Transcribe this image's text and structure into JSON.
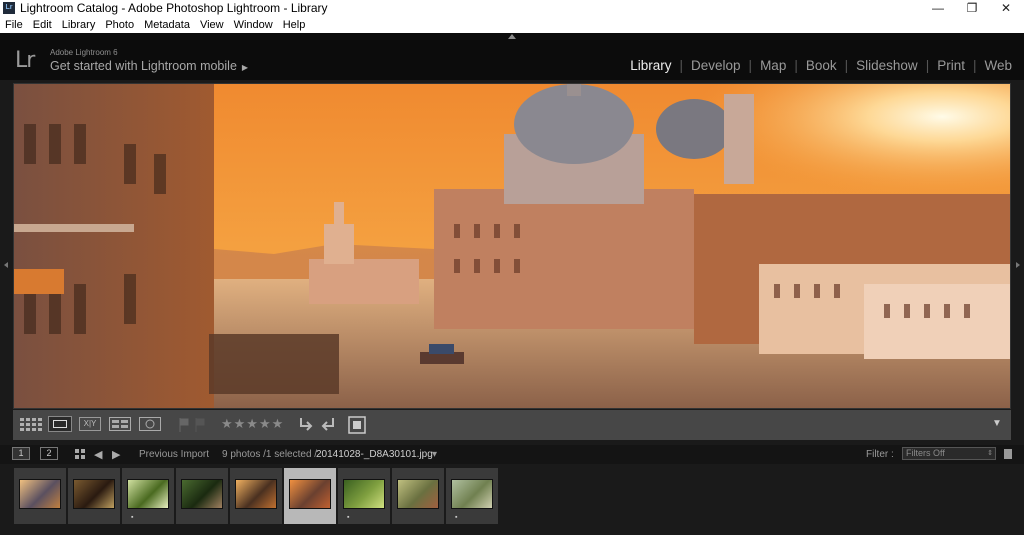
{
  "window": {
    "title": "Lightroom Catalog - Adobe Photoshop Lightroom - Library",
    "app_icon": "Lr",
    "minimize": "—",
    "restore": "❐",
    "close": "✕"
  },
  "menu": [
    "File",
    "Edit",
    "Library",
    "Photo",
    "Metadata",
    "View",
    "Window",
    "Help"
  ],
  "identity": {
    "logo": "Lr",
    "small_text": "Adobe Lightroom 6",
    "tagline": "Get started with Lightroom mobile",
    "tagline_arrow": "▶"
  },
  "modules": [
    {
      "label": "Library",
      "active": true
    },
    {
      "label": "Develop",
      "active": false
    },
    {
      "label": "Map",
      "active": false
    },
    {
      "label": "Book",
      "active": false
    },
    {
      "label": "Slideshow",
      "active": false
    },
    {
      "label": "Print",
      "active": false
    },
    {
      "label": "Web",
      "active": false
    }
  ],
  "toolbar": {
    "grid_icon": "grid-view-icon",
    "loupe_icon": "loupe-view-icon",
    "compare_label": "X|Y",
    "survey_icon": "survey-view-icon",
    "people_icon": "people-view-icon",
    "stars": "★★★★★",
    "menu_arrow": "▼"
  },
  "filmstrip_header": {
    "monitor1": "1",
    "monitor2": "2",
    "source": "Previous Import",
    "count": "9 photos /1 selected /",
    "filename": "20141028-_D8A30101.jpg",
    "filename_arrow": "▾",
    "filter_label": "Filter :",
    "filter_value": "Filters Off"
  },
  "thumbnails": [
    {
      "colors": [
        "#f0c080",
        "#5a5060",
        "#c08040"
      ],
      "marked": false,
      "selected": false
    },
    {
      "colors": [
        "#7a5a30",
        "#2a1a10",
        "#c0a060"
      ],
      "marked": false,
      "selected": false
    },
    {
      "colors": [
        "#d0e0a0",
        "#4a6a20",
        "#e8f0c0"
      ],
      "marked": true,
      "selected": false
    },
    {
      "colors": [
        "#4a6a30",
        "#1a2a10",
        "#a08060"
      ],
      "marked": false,
      "selected": false
    },
    {
      "colors": [
        "#f0b060",
        "#4a3020",
        "#c07030"
      ],
      "marked": false,
      "selected": false
    },
    {
      "colors": [
        "#f09040",
        "#6a4030",
        "#c06030"
      ],
      "marked": false,
      "selected": true
    },
    {
      "colors": [
        "#3a6020",
        "#80a040",
        "#d0e080"
      ],
      "marked": true,
      "selected": false
    },
    {
      "colors": [
        "#c0c080",
        "#6a7040",
        "#a06040"
      ],
      "marked": false,
      "selected": false
    },
    {
      "colors": [
        "#b0c0a0",
        "#708050",
        "#d0d0b0"
      ],
      "marked": true,
      "selected": false
    }
  ],
  "colors": {
    "active_module": "#eeeeee",
    "inactive_module": "#9a9a9a",
    "accent": "#f09040"
  }
}
